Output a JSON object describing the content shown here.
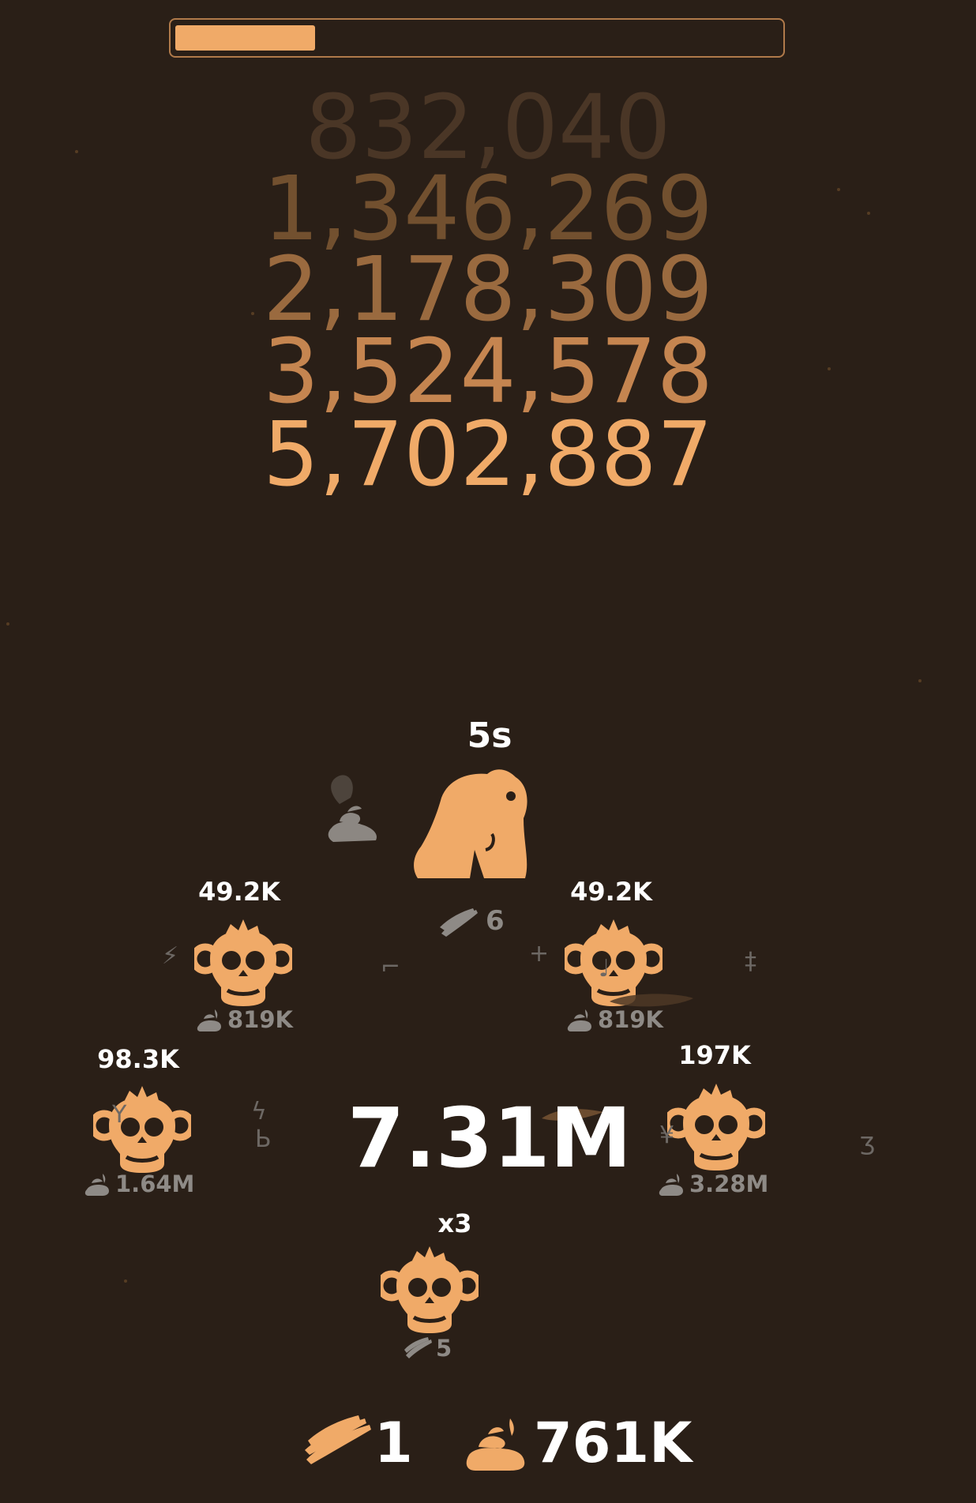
{
  "progress": {
    "value": 0.23,
    "color": "#f0aa68"
  },
  "sequence": [
    {
      "text": "832,040",
      "color": "#4a3626"
    },
    {
      "text": "1,346,269",
      "color": "#72502f"
    },
    {
      "text": "2,178,309",
      "color": "#9a6a3f"
    },
    {
      "text": "3,524,578",
      "color": "#c58550"
    },
    {
      "text": "5,702,887",
      "color": "#f0aa68"
    }
  ],
  "gorilla": {
    "timer": "5s",
    "cost": "6"
  },
  "monkeys": [
    {
      "value": "49.2K",
      "cost": "819K"
    },
    {
      "value": "49.2K",
      "cost": "819K"
    },
    {
      "value": "98.3K",
      "cost": "1.64M"
    },
    {
      "value": "197K",
      "cost": "3.28M"
    },
    {
      "value": "x3",
      "cost": "5"
    }
  ],
  "center_total": "7.31M",
  "bottom": {
    "bananas": "1",
    "poop": "761K"
  },
  "icons": {
    "gorilla": "gorilla-icon",
    "monkey": "monkey-skull-icon",
    "banana": "banana-bunch-icon",
    "poop": "poop-icon"
  }
}
